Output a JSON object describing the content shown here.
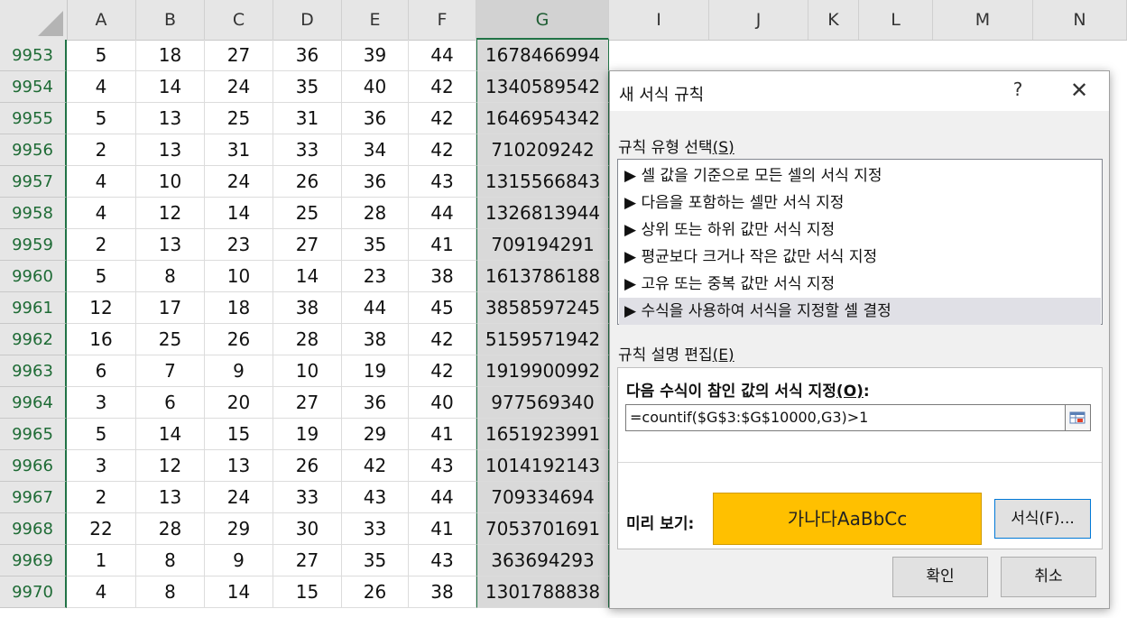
{
  "sheet": {
    "columns": [
      "A",
      "B",
      "C",
      "D",
      "E",
      "F",
      "G",
      "I",
      "J",
      "K",
      "L",
      "M",
      "N"
    ],
    "rows": [
      {
        "id": "9953",
        "cells": [
          "5",
          "18",
          "27",
          "36",
          "39",
          "44",
          "1678466994"
        ]
      },
      {
        "id": "9954",
        "cells": [
          "4",
          "14",
          "24",
          "35",
          "40",
          "42",
          "1340589542"
        ]
      },
      {
        "id": "9955",
        "cells": [
          "5",
          "13",
          "25",
          "31",
          "36",
          "42",
          "1646954342"
        ]
      },
      {
        "id": "9956",
        "cells": [
          "2",
          "13",
          "31",
          "33",
          "34",
          "42",
          "710209242"
        ]
      },
      {
        "id": "9957",
        "cells": [
          "4",
          "10",
          "24",
          "26",
          "36",
          "43",
          "1315566843"
        ]
      },
      {
        "id": "9958",
        "cells": [
          "4",
          "12",
          "14",
          "25",
          "28",
          "44",
          "1326813944"
        ]
      },
      {
        "id": "9959",
        "cells": [
          "2",
          "13",
          "23",
          "27",
          "35",
          "41",
          "709194291"
        ]
      },
      {
        "id": "9960",
        "cells": [
          "5",
          "8",
          "10",
          "14",
          "23",
          "38",
          "1613786188"
        ]
      },
      {
        "id": "9961",
        "cells": [
          "12",
          "17",
          "18",
          "38",
          "44",
          "45",
          "3858597245"
        ]
      },
      {
        "id": "9962",
        "cells": [
          "16",
          "25",
          "26",
          "28",
          "38",
          "42",
          "5159571942"
        ]
      },
      {
        "id": "9963",
        "cells": [
          "6",
          "7",
          "9",
          "10",
          "19",
          "42",
          "1919900992"
        ]
      },
      {
        "id": "9964",
        "cells": [
          "3",
          "6",
          "20",
          "27",
          "36",
          "40",
          "977569340"
        ]
      },
      {
        "id": "9965",
        "cells": [
          "5",
          "14",
          "15",
          "19",
          "29",
          "41",
          "1651923991"
        ]
      },
      {
        "id": "9966",
        "cells": [
          "3",
          "12",
          "13",
          "26",
          "42",
          "43",
          "1014192143"
        ]
      },
      {
        "id": "9967",
        "cells": [
          "2",
          "13",
          "24",
          "33",
          "43",
          "44",
          "709334694"
        ]
      },
      {
        "id": "9968",
        "cells": [
          "22",
          "28",
          "29",
          "30",
          "33",
          "41",
          "7053701691"
        ]
      },
      {
        "id": "9969",
        "cells": [
          "1",
          "8",
          "9",
          "27",
          "35",
          "43",
          "363694293"
        ]
      },
      {
        "id": "9970",
        "cells": [
          "4",
          "8",
          "14",
          "15",
          "26",
          "38",
          "1301788838"
        ]
      }
    ],
    "selected_column": "G",
    "accent_color": "#217346"
  },
  "dialog": {
    "title": "새 서식 규칙",
    "help_label": "?",
    "close_label": "✕",
    "rule_type_label": "규칙 유형 선택",
    "rule_type_key": "(S)",
    "rule_types": [
      "▶ 셀 값을 기준으로 모든 셀의 서식 지정",
      "▶ 다음을 포함하는 셀만 서식 지정",
      "▶ 상위 또는 하위 값만 서식 지정",
      "▶ 평균보다 크거나 작은 값만 서식 지정",
      "▶ 고유 또는 중복 값만 서식 지정",
      "▶ 수식을 사용하여 서식을 지정할 셀 결정"
    ],
    "selected_rule_index": 5,
    "edit_label": "규칙 설명 편집",
    "edit_key": "(E)",
    "formula_label": "다음 수식이 참인 값의 서식 지정",
    "formula_key": "(O)",
    "formula_value": "=countif($G$3:$G$10000,G3)>1",
    "preview_label": "미리 보기:",
    "preview_text": "가나다AaBbCc",
    "preview_color": "#ffc000",
    "format_button": "서식(F)...",
    "ok_button": "확인",
    "cancel_button": "취소"
  }
}
